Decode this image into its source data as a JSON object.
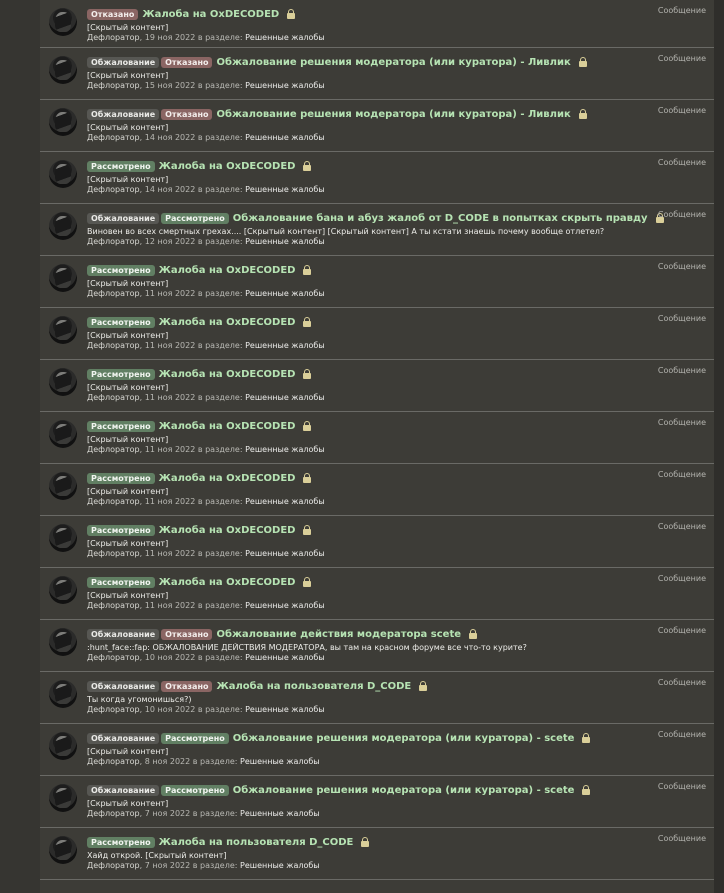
{
  "rows": [
    {
      "badges": [
        {
          "label": "Отказано",
          "kind": "denied"
        }
      ],
      "title": "Жалоба на OxDECODED",
      "snippet": "[Скрытый контент]",
      "author": "Дефлоратор",
      "date": "19 ноя 2022",
      "section_prefix": "в разделе:",
      "forum": "Решенные жалобы",
      "type": "Сообщение"
    },
    {
      "badges": [
        {
          "label": "Обжалование",
          "kind": "appeal"
        },
        {
          "label": "Отказано",
          "kind": "denied"
        }
      ],
      "title": "Обжалование решения модератора (или куратора) - Ливлик",
      "snippet": "[Скрытый контент]",
      "author": "Дефлоратор",
      "date": "15 ноя 2022",
      "section_prefix": "в разделе:",
      "forum": "Решенные жалобы",
      "type": "Сообщение"
    },
    {
      "badges": [
        {
          "label": "Обжалование",
          "kind": "appeal"
        },
        {
          "label": "Отказано",
          "kind": "denied"
        }
      ],
      "title": "Обжалование решения модератора (или куратора) - Ливлик",
      "snippet": "[Скрытый контент]",
      "author": "Дефлоратор",
      "date": "14 ноя 2022",
      "section_prefix": "в разделе:",
      "forum": "Решенные жалобы",
      "type": "Сообщение"
    },
    {
      "badges": [
        {
          "label": "Рассмотрено",
          "kind": "reviewed"
        }
      ],
      "title": "Жалоба на OxDECODED",
      "snippet": "[Скрытый контент]",
      "author": "Дефлоратор",
      "date": "14 ноя 2022",
      "section_prefix": "в разделе:",
      "forum": "Решенные жалобы",
      "type": "Сообщение"
    },
    {
      "badges": [
        {
          "label": "Обжалование",
          "kind": "appeal"
        },
        {
          "label": "Рассмотрено",
          "kind": "reviewed"
        }
      ],
      "title": "Обжалование бана и абуз жалоб от D_CODE в попытках скрыть правду",
      "snippet": "Виновен во всех смертных грехах.... [Скрытый контент] [Скрытый контент] А ты кстати знаешь почему вообще отлетел?",
      "author": "Дефлоратор",
      "date": "12 ноя 2022",
      "section_prefix": "в разделе:",
      "forum": "Решенные жалобы",
      "type": "Сообщение"
    },
    {
      "badges": [
        {
          "label": "Рассмотрено",
          "kind": "reviewed"
        }
      ],
      "title": "Жалоба на OxDECODED",
      "snippet": "[Скрытый контент]",
      "author": "Дефлоратор",
      "date": "11 ноя 2022",
      "section_prefix": "в разделе:",
      "forum": "Решенные жалобы",
      "type": "Сообщение"
    },
    {
      "badges": [
        {
          "label": "Рассмотрено",
          "kind": "reviewed"
        }
      ],
      "title": "Жалоба на OxDECODED",
      "snippet": "[Скрытый контент]",
      "author": "Дефлоратор",
      "date": "11 ноя 2022",
      "section_prefix": "в разделе:",
      "forum": "Решенные жалобы",
      "type": "Сообщение"
    },
    {
      "badges": [
        {
          "label": "Рассмотрено",
          "kind": "reviewed"
        }
      ],
      "title": "Жалоба на OxDECODED",
      "snippet": "[Скрытый контент]",
      "author": "Дефлоратор",
      "date": "11 ноя 2022",
      "section_prefix": "в разделе:",
      "forum": "Решенные жалобы",
      "type": "Сообщение"
    },
    {
      "badges": [
        {
          "label": "Рассмотрено",
          "kind": "reviewed"
        }
      ],
      "title": "Жалоба на OxDECODED",
      "snippet": "[Скрытый контент]",
      "author": "Дефлоратор",
      "date": "11 ноя 2022",
      "section_prefix": "в разделе:",
      "forum": "Решенные жалобы",
      "type": "Сообщение"
    },
    {
      "badges": [
        {
          "label": "Рассмотрено",
          "kind": "reviewed"
        }
      ],
      "title": "Жалоба на OxDECODED",
      "snippet": "[Скрытый контент]",
      "author": "Дефлоратор",
      "date": "11 ноя 2022",
      "section_prefix": "в разделе:",
      "forum": "Решенные жалобы",
      "type": "Сообщение"
    },
    {
      "badges": [
        {
          "label": "Рассмотрено",
          "kind": "reviewed"
        }
      ],
      "title": "Жалоба на OxDECODED",
      "snippet": "[Скрытый контент]",
      "author": "Дефлоратор",
      "date": "11 ноя 2022",
      "section_prefix": "в разделе:",
      "forum": "Решенные жалобы",
      "type": "Сообщение"
    },
    {
      "badges": [
        {
          "label": "Рассмотрено",
          "kind": "reviewed"
        }
      ],
      "title": "Жалоба на OxDECODED",
      "snippet": "[Скрытый контент]",
      "author": "Дефлоратор",
      "date": "11 ноя 2022",
      "section_prefix": "в разделе:",
      "forum": "Решенные жалобы",
      "type": "Сообщение"
    },
    {
      "badges": [
        {
          "label": "Обжалование",
          "kind": "appeal"
        },
        {
          "label": "Отказано",
          "kind": "denied"
        }
      ],
      "title": "Обжалование действия модератора scete",
      "snippet": ":hunt_face::fap: ОБЖАЛОВАНИЕ ДЕЙСТВИЯ МОДЕРАТОРА, вы там на красном форуме все что-то курите?",
      "author": "Дефлоратор",
      "date": "10 ноя 2022",
      "section_prefix": "в разделе:",
      "forum": "Решенные жалобы",
      "type": "Сообщение"
    },
    {
      "badges": [
        {
          "label": "Обжалование",
          "kind": "appeal"
        },
        {
          "label": "Отказано",
          "kind": "denied"
        }
      ],
      "title": "Жалоба на пользователя D_CODE",
      "snippet": "Ты когда угомонишься?)",
      "author": "Дефлоратор",
      "date": "10 ноя 2022",
      "section_prefix": "в разделе:",
      "forum": "Решенные жалобы",
      "type": "Сообщение"
    },
    {
      "badges": [
        {
          "label": "Обжалование",
          "kind": "appeal"
        },
        {
          "label": "Рассмотрено",
          "kind": "reviewed"
        }
      ],
      "title": "Обжалование решения модератора (или куратора) - scete",
      "snippet": "[Скрытый контент]",
      "author": "Дефлоратор",
      "date": "8 ноя 2022",
      "section_prefix": "в разделе:",
      "forum": "Решенные жалобы",
      "type": "Сообщение"
    },
    {
      "badges": [
        {
          "label": "Обжалование",
          "kind": "appeal"
        },
        {
          "label": "Рассмотрено",
          "kind": "reviewed"
        }
      ],
      "title": "Обжалование решения модератора (или куратора) - scete",
      "snippet": "[Скрытый контент]",
      "author": "Дефлоратор",
      "date": "7 ноя 2022",
      "section_prefix": "в разделе:",
      "forum": "Решенные жалобы",
      "type": "Сообщение"
    },
    {
      "badges": [
        {
          "label": "Рассмотрено",
          "kind": "reviewed"
        }
      ],
      "title": "Жалоба на пользователя D_CODE",
      "snippet": "Хайд открой. [Скрытый контент]",
      "author": "Дефлоратор",
      "date": "7 ноя 2022",
      "section_prefix": "в разделе:",
      "forum": "Решенные жалобы",
      "type": "Сообщение"
    }
  ],
  "colors": {
    "background": "#353430",
    "panel": "#3d3c37",
    "title": "#b6e3b3",
    "badge_appeal": "#575753",
    "badge_denied": "#8a6563",
    "badge_reviewed": "#617f63",
    "lock": "#dacf99"
  },
  "icons": {
    "lock": "lock-icon",
    "avatar": "user-avatar"
  }
}
